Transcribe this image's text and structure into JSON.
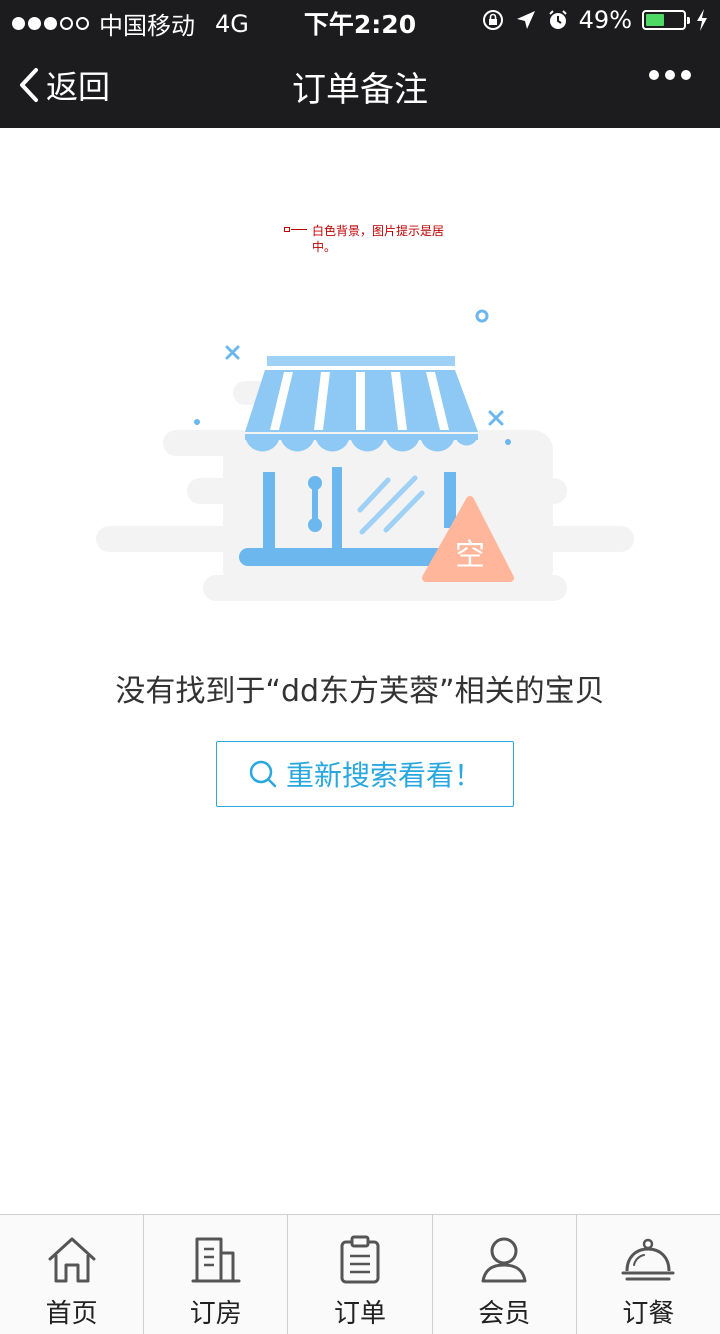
{
  "status_bar": {
    "carrier": "中国移动",
    "network": "4G",
    "time": "下午2:20",
    "battery": "49%",
    "battery_level": 0.49,
    "battery_color": "#4cd964"
  },
  "nav": {
    "back_label": "返回",
    "title": "订单备注",
    "more_icon": "more-dots-icon"
  },
  "annotation": {
    "text": "白色背景，图片提示是居中。"
  },
  "empty_state": {
    "badge": "空",
    "message": "没有找到于“dd东方芙蓉”相关的宝贝",
    "button_label": "重新搜索看看！",
    "button_icon": "search-icon",
    "accent_color": "#29a8e0",
    "badge_color": "#ffb69a"
  },
  "tabs": [
    {
      "label": "首页",
      "icon": "home-icon"
    },
    {
      "label": "订房",
      "icon": "building-icon"
    },
    {
      "label": "订单",
      "icon": "clipboard-icon"
    },
    {
      "label": "会员",
      "icon": "user-icon"
    },
    {
      "label": "订餐",
      "icon": "dish-cover-icon"
    }
  ]
}
